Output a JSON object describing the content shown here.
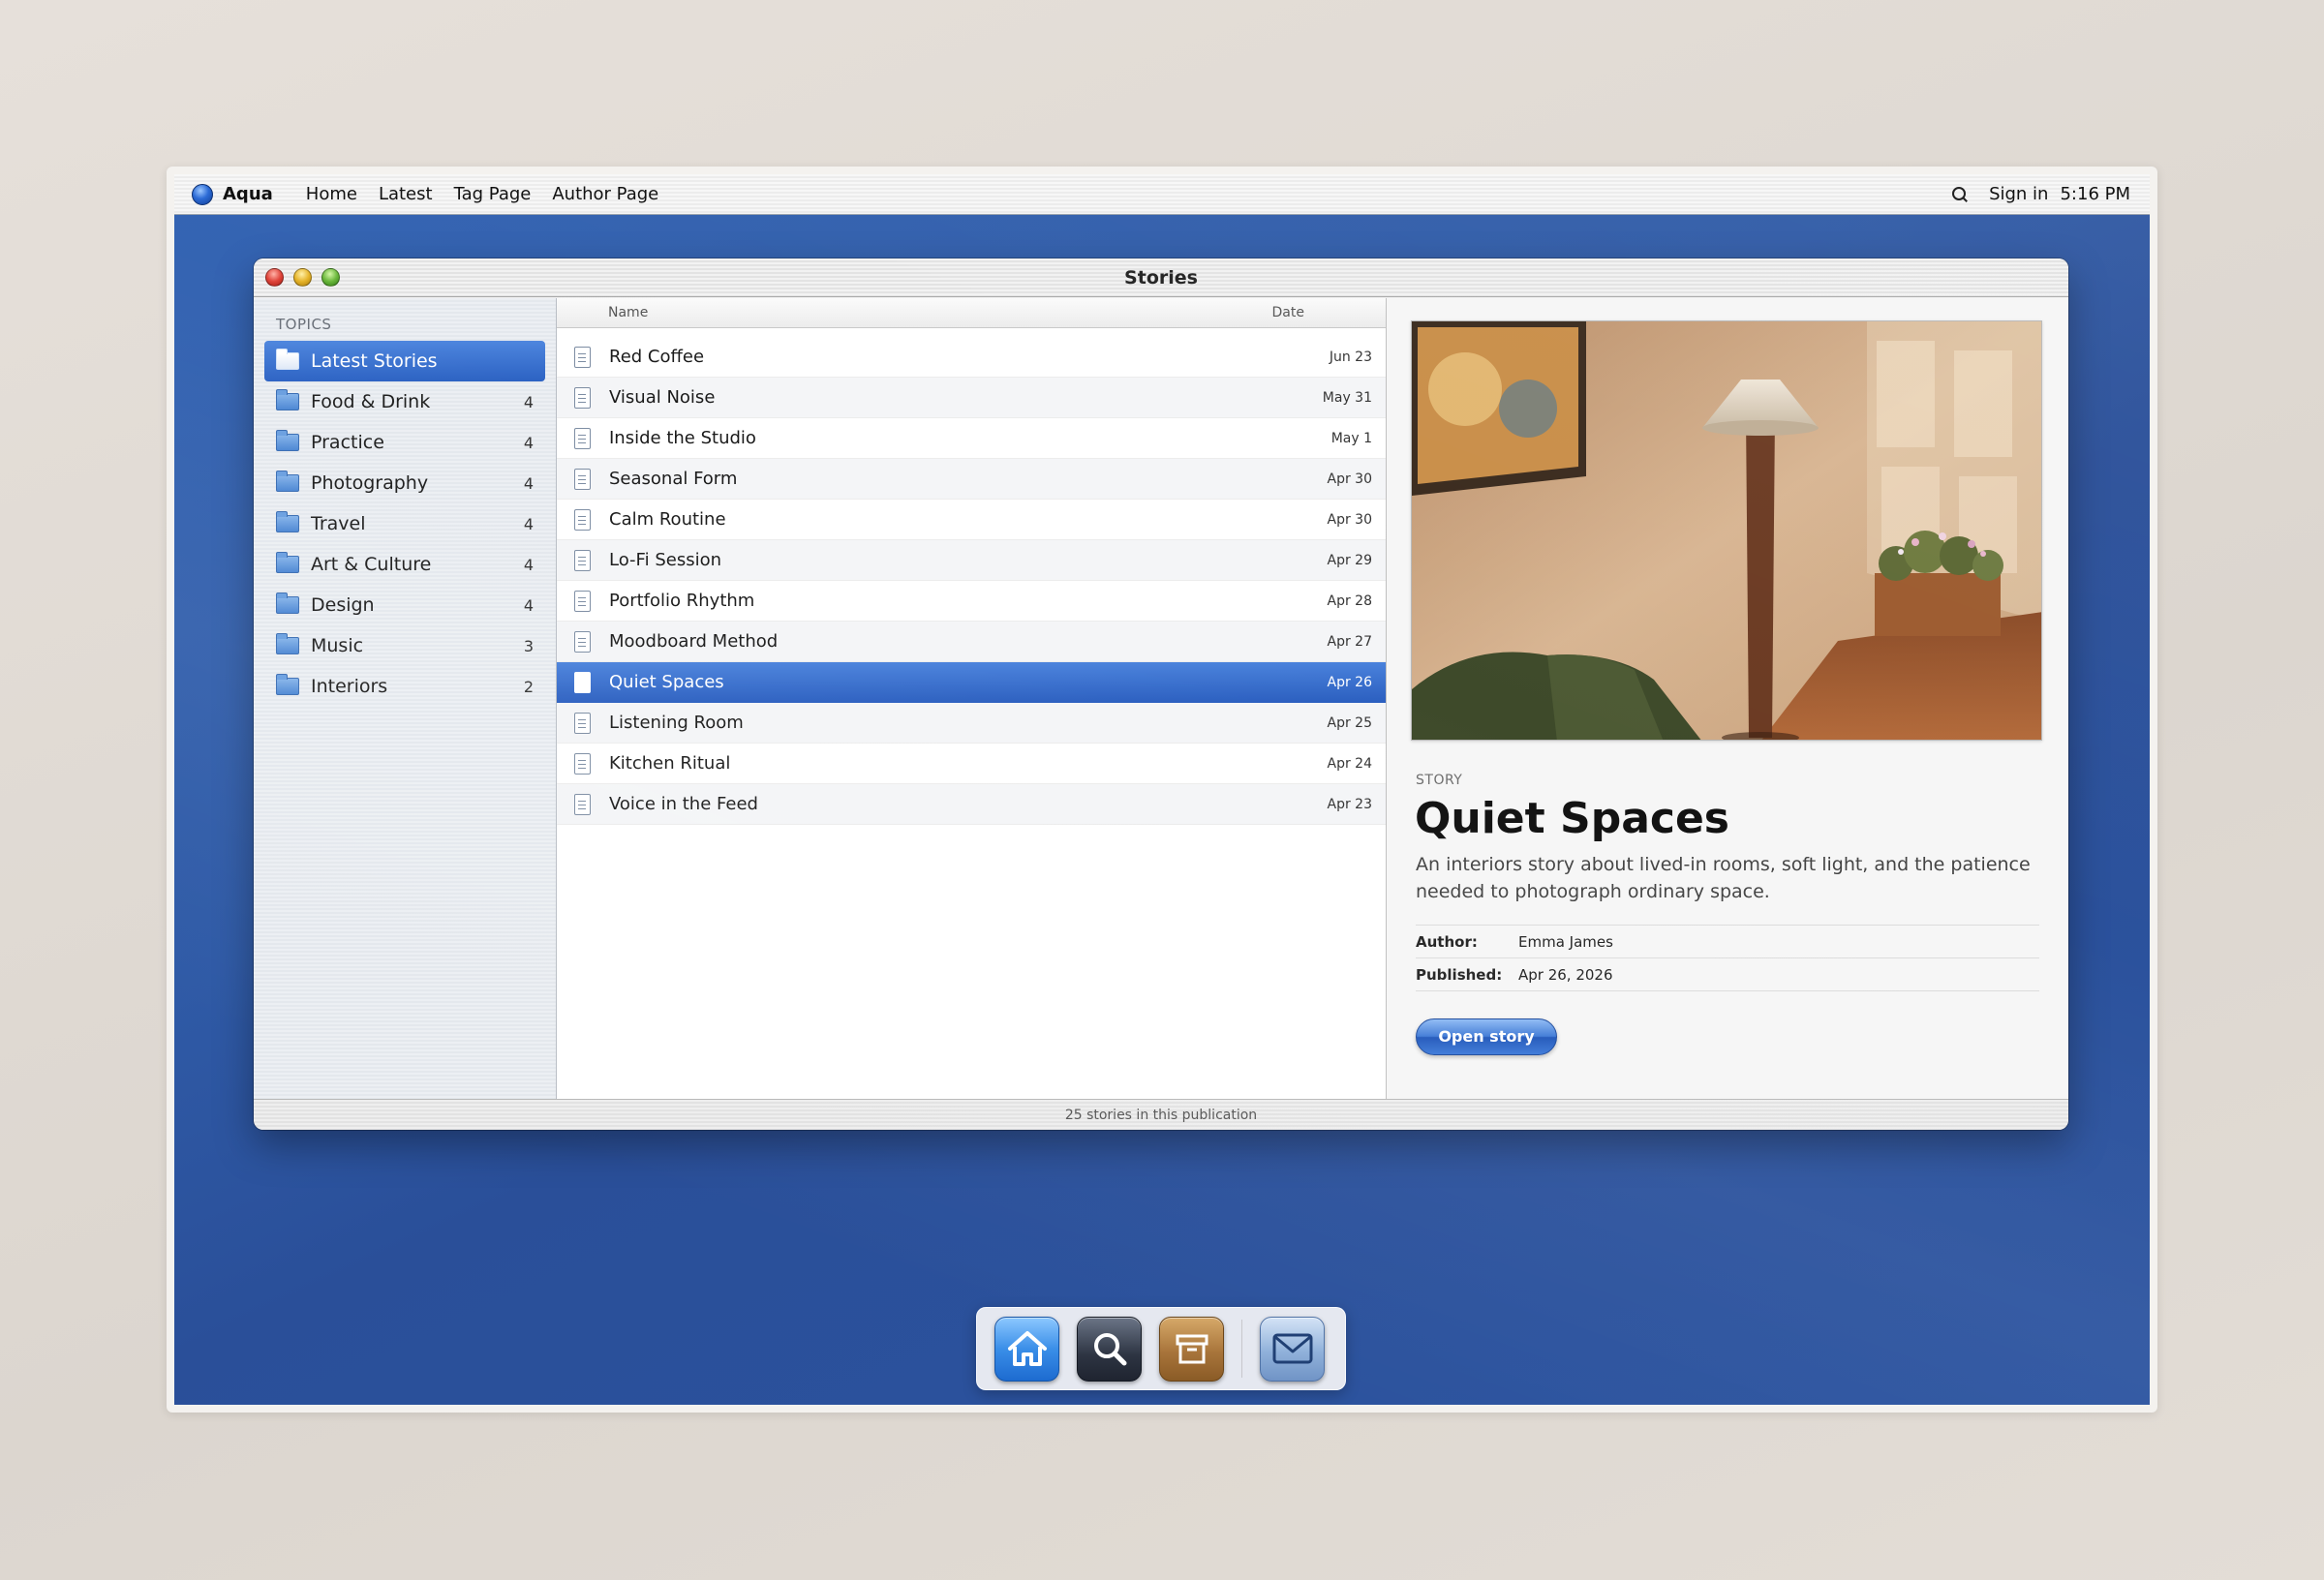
{
  "menubar": {
    "app_name": "Aqua",
    "items": [
      "Home",
      "Latest",
      "Tag Page",
      "Author Page"
    ],
    "sign_in": "Sign in",
    "clock": "5:16 PM"
  },
  "window": {
    "title": "Stories",
    "status": "25 stories in this publication"
  },
  "sidebar": {
    "heading": "TOPICS",
    "items": [
      {
        "label": "Latest Stories",
        "count": ""
      },
      {
        "label": "Food & Drink",
        "count": "4"
      },
      {
        "label": "Practice",
        "count": "4"
      },
      {
        "label": "Photography",
        "count": "4"
      },
      {
        "label": "Travel",
        "count": "4"
      },
      {
        "label": "Art & Culture",
        "count": "4"
      },
      {
        "label": "Design",
        "count": "4"
      },
      {
        "label": "Music",
        "count": "3"
      },
      {
        "label": "Interiors",
        "count": "2"
      }
    ]
  },
  "list": {
    "columns": {
      "name": "Name",
      "date": "Date"
    },
    "rows": [
      {
        "name": "Red Coffee",
        "date": "Jun 23"
      },
      {
        "name": "Visual Noise",
        "date": "May 31"
      },
      {
        "name": "Inside the Studio",
        "date": "May 1"
      },
      {
        "name": "Seasonal Form",
        "date": "Apr 30"
      },
      {
        "name": "Calm Routine",
        "date": "Apr 30"
      },
      {
        "name": "Lo-Fi Session",
        "date": "Apr 29"
      },
      {
        "name": "Portfolio Rhythm",
        "date": "Apr 28"
      },
      {
        "name": "Moodboard Method",
        "date": "Apr 27"
      },
      {
        "name": "Quiet Spaces",
        "date": "Apr 26"
      },
      {
        "name": "Listening Room",
        "date": "Apr 25"
      },
      {
        "name": "Kitchen Ritual",
        "date": "Apr 24"
      },
      {
        "name": "Voice in the Feed",
        "date": "Apr 23"
      }
    ]
  },
  "detail": {
    "label": "STORY",
    "title": "Quiet Spaces",
    "description": "An interiors story about lived-in rooms, soft light, and the patience needed to photograph ordinary space.",
    "author_label": "Author:",
    "author": "Emma James",
    "published_label": "Published:",
    "published": "Apr 26, 2026",
    "button": "Open story"
  },
  "dock": {
    "icons": [
      "home-icon",
      "search-icon",
      "archive-icon",
      "mail-icon"
    ]
  },
  "colors": {
    "desktop": "#2f5aa6",
    "selection": "#2c62c3",
    "accent": "#3f7ad6"
  }
}
